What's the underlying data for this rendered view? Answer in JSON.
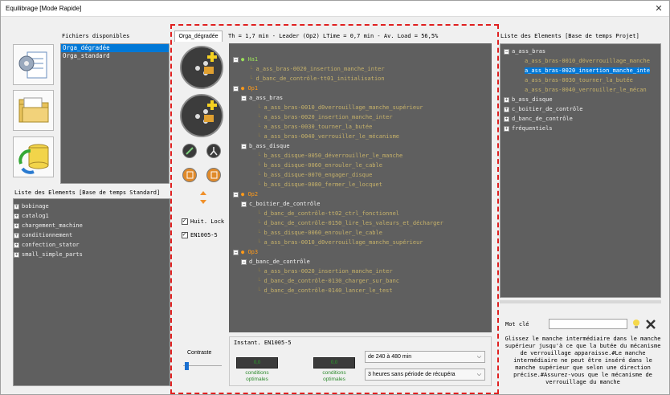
{
  "window": {
    "title": "Equilibrage [Mode Rapide]",
    "close_label": "✕"
  },
  "files": {
    "label": "Fichiers disponibles",
    "items": [
      {
        "label": "Orga_dégradée",
        "selected": true
      },
      {
        "label": "Orga_standard",
        "selected": false
      }
    ]
  },
  "std_elements": {
    "label": "Liste des Elements [Base de temps Standard]",
    "items": [
      "bobinage",
      "catalog1",
      "chargement_machine",
      "conditionnement",
      "confection_stator",
      "small_simple_parts"
    ]
  },
  "center": {
    "tab_label": "Orga_dégradée",
    "status": "Th = 1,7 min - Leader (Op2) LTime = 0,7 min - Av. Load = 56,5%",
    "checkbox_lock": "Huit. Lock",
    "checkbox_en": "EN1005-5",
    "contrast_label": "Contraste"
  },
  "tree": [
    {
      "kind": "op",
      "label": "Ha1",
      "indent": 0,
      "color": "#9be05a"
    },
    {
      "kind": "leaf",
      "label": "a_ass_bras-0020_insertion_manche_inter",
      "indent": 2
    },
    {
      "kind": "leaf",
      "label": "d_banc_de_contrôle-tt01_initialisation",
      "indent": 2
    },
    {
      "kind": "op",
      "label": "Op1",
      "indent": 0,
      "color": "#ff9a1a"
    },
    {
      "kind": "group",
      "label": "a_ass_bras",
      "indent": 1
    },
    {
      "kind": "leaf",
      "label": "a_ass_bras-0010_d0verrouillage_manche_supérieur",
      "indent": 3
    },
    {
      "kind": "leaf",
      "label": "a_ass_bras-0020_insertion_manche_inter",
      "indent": 3
    },
    {
      "kind": "leaf",
      "label": "a_ass_bras-0030_tourner_la_butée",
      "indent": 3
    },
    {
      "kind": "leaf",
      "label": "a_ass_bras-0040_verrouiller_le_mécanisme",
      "indent": 3
    },
    {
      "kind": "group",
      "label": "b_ass_disque",
      "indent": 1
    },
    {
      "kind": "leaf",
      "label": "b_ass_disque-0050_déverrouiller_le_manche",
      "indent": 3
    },
    {
      "kind": "leaf",
      "label": "b_ass_disque-0060_enrouler_le_cable",
      "indent": 3
    },
    {
      "kind": "leaf",
      "label": "b_ass_disque-0070_engager_disque",
      "indent": 3
    },
    {
      "kind": "leaf",
      "label": "b_ass_disque-0080_fermer_le_locquet",
      "indent": 3
    },
    {
      "kind": "op",
      "label": "Op2",
      "indent": 0,
      "color": "#ff9a1a"
    },
    {
      "kind": "group",
      "label": "c_boitier_de_contrôle",
      "indent": 1
    },
    {
      "kind": "leaf",
      "label": "d_banc_de_contrôle-tt02_ctrl_fonctionnel",
      "indent": 3
    },
    {
      "kind": "leaf",
      "label": "d_banc_de_contrôle-0150_lire_les_valeurs_et_décharger",
      "indent": 3
    },
    {
      "kind": "leaf",
      "label": "b_ass_disque-0060_enrouler_le_cable",
      "indent": 3
    },
    {
      "kind": "leaf",
      "label": "a_ass_bras-0010_d0verrouillage_manche_supérieur",
      "indent": 3
    },
    {
      "kind": "op",
      "label": "Op3",
      "indent": 0,
      "color": "#ff9a1a"
    },
    {
      "kind": "group",
      "label": "d_banc_de_contrôle",
      "indent": 1
    },
    {
      "kind": "leaf",
      "label": "a_ass_bras-0020_insertion_manche_inter",
      "indent": 3
    },
    {
      "kind": "leaf",
      "label": "d_banc_de_contrôle-0130_charger_sur_banc",
      "indent": 3
    },
    {
      "kind": "leaf",
      "label": "d_banc_de_contrôle-0140_lancer_le_test",
      "indent": 3
    }
  ],
  "bottom": {
    "title": "Instant. EN1005-5",
    "gauge1_text": "0,0",
    "gauge2_text": "0,0",
    "cond1": "conditions optimales",
    "cond2": "conditions optimales",
    "select1": "de 240 à 480 min",
    "select2": "3 heures sans période de récupéra"
  },
  "project": {
    "label": "Liste des Elements [Base de temps Projet]",
    "items": [
      {
        "label": "a_ass_bras",
        "kind": "group"
      },
      {
        "label": "a_ass_bras-0010_d0verrouillage_manche",
        "kind": "leaf",
        "selected": false
      },
      {
        "label": "a_ass_bras-0020_insertion_manche_inte",
        "kind": "leaf",
        "selected": true
      },
      {
        "label": "a_ass_bras-0030_tourner_la_butée",
        "kind": "leaf",
        "selected": false
      },
      {
        "label": "a_ass_bras-0040_verrouiller_le_mécan",
        "kind": "leaf",
        "selected": false
      },
      {
        "label": "b_ass_disque",
        "kind": "group"
      },
      {
        "label": "c_boitier_de_contrôle",
        "kind": "group"
      },
      {
        "label": "d_banc_de_contrôle",
        "kind": "group"
      },
      {
        "label": "fréquentiels",
        "kind": "group"
      }
    ],
    "keyword_label": "Mot clé",
    "keyword_value": "",
    "help": "Glissez le manche intermédiaire dans le manche supérieur jusqu'à ce que la butée du mécanisme de verrouillage apparaisse.#Le manche intermédiaire ne peut être inséré dans le manche supérieur que selon une direction précise.#Assurez-vous que le mécanisme de verrouillage du manche"
  },
  "colors": {
    "tree_text": "#c7b26a",
    "tree_dark_text": "#f0f0f0",
    "selection": "#0078d7",
    "highlight": "#e02020"
  }
}
